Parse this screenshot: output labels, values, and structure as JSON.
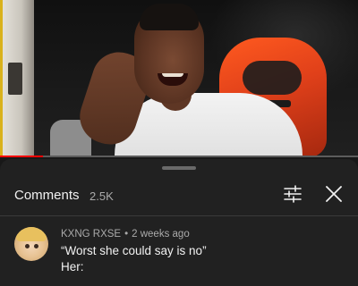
{
  "video": {
    "progress_fraction": 0.12,
    "progress_color": "#ff0000"
  },
  "comments_panel": {
    "title": "Comments",
    "count": "2.5K",
    "filter_icon": "sliders-icon",
    "close_icon": "close-icon"
  },
  "comment": {
    "author": "KXNG RXSE",
    "separator": "•",
    "time": "2 weeks ago",
    "lines": [
      "“Worst she could say is no”",
      "Her:"
    ]
  }
}
